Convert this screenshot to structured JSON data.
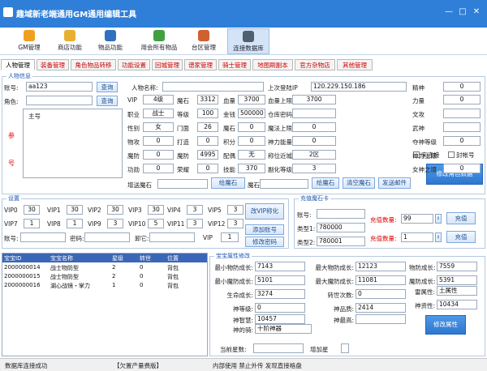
{
  "window": {
    "title": "趣域新老端通用GM通用编辑工具",
    "controls": [
      "—",
      "□",
      "✕"
    ]
  },
  "toolbar": [
    {
      "label": "GM管理",
      "color": "#f0a020"
    },
    {
      "label": "商店功能",
      "color": "#e8b030"
    },
    {
      "label": "物品功能",
      "color": "#3070c0"
    },
    {
      "label": "用会所有物品",
      "color": "#40a040"
    },
    {
      "label": "台区管理",
      "color": "#d06030"
    },
    {
      "label": "连接数据库",
      "color": "#506070"
    }
  ],
  "tabs": [
    "人物管理",
    "装备管理",
    "角色物品转移",
    "功能设置",
    "回城管理",
    "谱家管理",
    "骑士管理",
    "地图刷副本",
    "官方杂物店",
    "其他管理"
  ],
  "player": {
    "group_title": "人物信息",
    "account_label": "账号:",
    "account_value": "aa123",
    "query_btn": "查询",
    "role_label": "角色:",
    "role_query_btn": "查询",
    "role_list": [
      "主号"
    ],
    "side_chars": [
      "参",
      "号"
    ],
    "name_label": "人物名称:",
    "name_value": "",
    "last_login_label": "上次登陆IP",
    "last_login_value": "120.229.150.186",
    "rows": [
      [
        "VIP",
        "4级",
        "魔石",
        "3312",
        "血量",
        "3700",
        "血量上限",
        "3700"
      ],
      [
        "职业",
        "战士",
        "等级",
        "100",
        "金钱",
        "500000",
        "仓库密码",
        ""
      ],
      [
        "性别",
        "女",
        "门面",
        "26",
        "魔石",
        "0",
        "魔法上限",
        "0"
      ],
      [
        "物攻",
        "0",
        "打造",
        "0",
        "积分",
        "0",
        "神力能量",
        "0"
      ],
      [
        "魔防",
        "0",
        "魔防",
        "4995",
        "配偶",
        "无",
        "称位近城",
        "2区"
      ],
      [
        "功勋",
        "0",
        "荣耀",
        "0",
        "技能",
        "370",
        "副化等级",
        "3"
      ]
    ],
    "right_labels": [
      "精神",
      "力量",
      "文攻",
      "武神",
      "夺神等级",
      "神力上限",
      "女神之境",
      "回避"
    ],
    "right_values": [
      "0",
      "0",
      "",
      "",
      "0",
      "0",
      "0",
      ""
    ],
    "check_a": "来连接",
    "check_b": "封帐号",
    "recharge_label": "增送魔石",
    "recharge_btn": "给魔石",
    "recharge2_label": "魔石",
    "recharge2_btn": "给魔石",
    "clear_btn": "清空魔石",
    "send_btn": "发送邮件",
    "modify_btn": "修改角色数据"
  },
  "vip": {
    "group_title": "设置",
    "labels": [
      "VIP0",
      "VIP1",
      "VIP2",
      "VIP3",
      "VIP4",
      "VIP5",
      "VIP6",
      "VIP7",
      "VIP8",
      "VIP9",
      "VIP10",
      "VIP11",
      "VIP12",
      "VIP13"
    ],
    "values": [
      "30",
      "30",
      "30",
      "30",
      "3",
      "3",
      "3",
      "1",
      "1",
      "3",
      "5",
      "3",
      "3",
      "3"
    ],
    "acc_label": "账号:",
    "pwd_label": "密码:",
    "pwd2_label": "卸它:",
    "vip_label": "VIP",
    "vip_value": "1",
    "btn_vip": "改VIP称化",
    "btn_add": "添加账号",
    "btn_pwd": "修改密码"
  },
  "card": {
    "group_title": "充值魔石卡",
    "acc_label": "账号:",
    "type1_label": "类型1:",
    "type1_value": "780000",
    "type2_label": "类型2:",
    "type2_value": "780001",
    "qty_label": "充值数量:",
    "qty1": "99",
    "qty2": "1",
    "btn": "充值"
  },
  "items": {
    "headers": [
      "宝宝ID",
      "宝宝名称",
      "星级",
      "转世",
      "位置"
    ],
    "rows": [
      [
        "2000000014",
        "战士物防型",
        "2",
        "0",
        "背包"
      ],
      [
        "2000000015",
        "战士物防型",
        "2",
        "0",
        "背包"
      ],
      [
        "2000000016",
        "湖心战镜・掌力",
        "1",
        "0",
        "背包"
      ]
    ]
  },
  "pet": {
    "group_title": "宝宝属性修改",
    "labels_l": [
      "最小物防成长:",
      "最小魔防成长:",
      "生命成长:",
      "神等级:",
      "神智慧:",
      "神的骑:"
    ],
    "values_l": [
      "7143",
      "5101",
      "3274",
      "0",
      "10457",
      "十阶神器"
    ],
    "labels_m": [
      "最大物防成长:",
      "最大魔防成长:",
      "转世次数:",
      "神品质:",
      "神最高:"
    ],
    "values_m": [
      "12123",
      "11081",
      "0",
      "2414",
      ""
    ],
    "labels_r": [
      "物防成长:",
      "魔防成长:",
      "雷属性:",
      "神资性:"
    ],
    "values_r": [
      "7559",
      "5391",
      "土属性",
      "10434"
    ],
    "star_label": "当前星数:",
    "add_label": "增加星",
    "btn": "修改属性"
  },
  "status": {
    "left": "数据库连接成功",
    "mid": "【欠置产量费版】",
    "right": "内部使用 禁止外传 发现直接格盘"
  }
}
